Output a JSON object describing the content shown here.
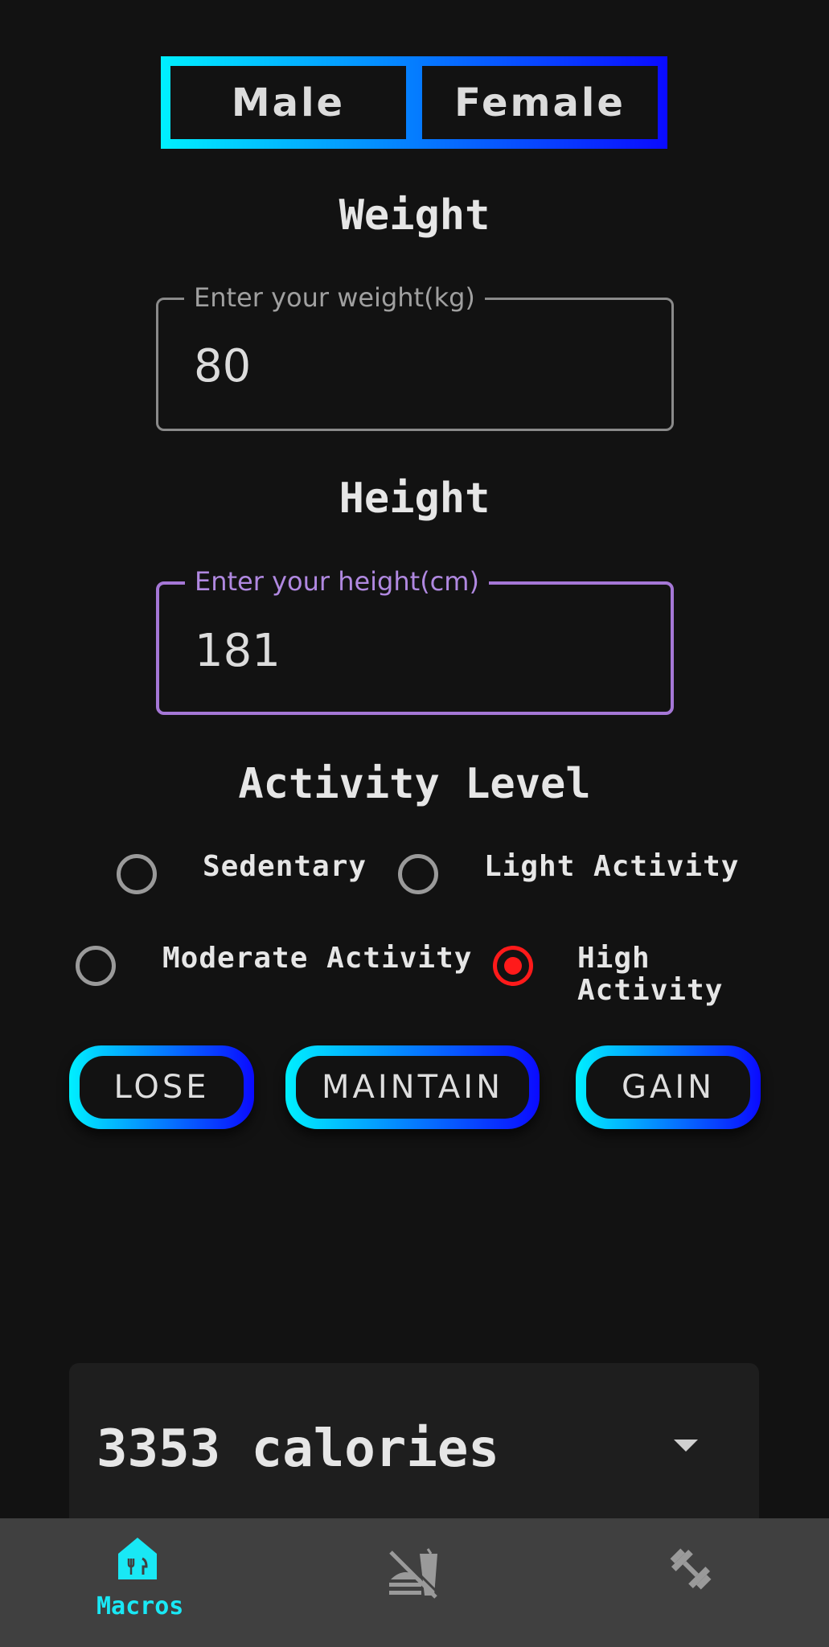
{
  "gender": {
    "male_label": "Male",
    "female_label": "Female"
  },
  "weight": {
    "heading": "Weight",
    "label": "Enter your weight(kg)",
    "value": "80"
  },
  "height": {
    "heading": "Height",
    "label": "Enter your height(cm)",
    "value": "181"
  },
  "activity": {
    "heading": "Activity Level",
    "options": [
      {
        "label": "Sedentary",
        "selected": false
      },
      {
        "label": "Light Activity",
        "selected": false
      },
      {
        "label": "Moderate Activity",
        "selected": false
      },
      {
        "label": "High Activity",
        "selected": true
      }
    ]
  },
  "goals": {
    "lose": "LOSE",
    "maintain": "MAINTAIN",
    "gain": "GAIN"
  },
  "result": {
    "calories": "3353 calories"
  },
  "bottom_nav": {
    "items": [
      {
        "label": "Macros",
        "icon": "home-food-icon",
        "active": true
      },
      {
        "label": "",
        "icon": "no-food-icon",
        "active": false
      },
      {
        "label": "",
        "icon": "dumbbell-icon",
        "active": false
      }
    ]
  },
  "colors": {
    "accent_cyan": "#00f0ff",
    "accent_blue": "#0a0aff",
    "focus_purple": "#a577d6",
    "selected_red": "#ff1a1a"
  }
}
